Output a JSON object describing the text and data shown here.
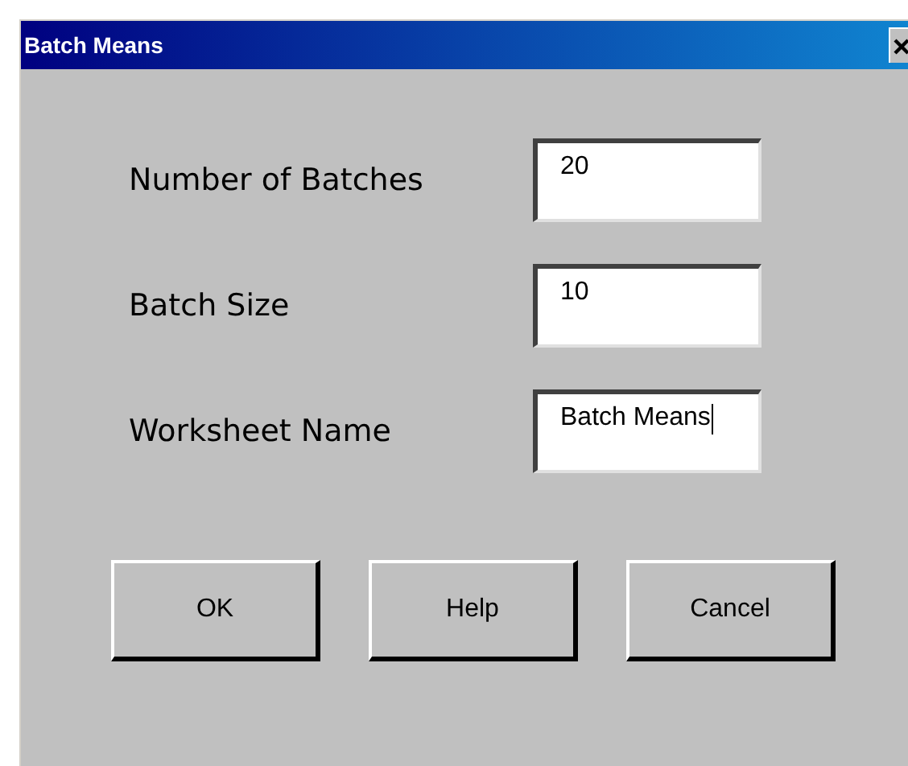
{
  "window": {
    "title": "Batch Means"
  },
  "fields": [
    {
      "label": "Number of Batches",
      "value": "20",
      "focused": false
    },
    {
      "label": "Batch Size",
      "value": "10",
      "focused": false
    },
    {
      "label": "Worksheet Name",
      "value": "Batch Means",
      "focused": true
    }
  ],
  "buttons": [
    "OK",
    "Help",
    "Cancel"
  ]
}
